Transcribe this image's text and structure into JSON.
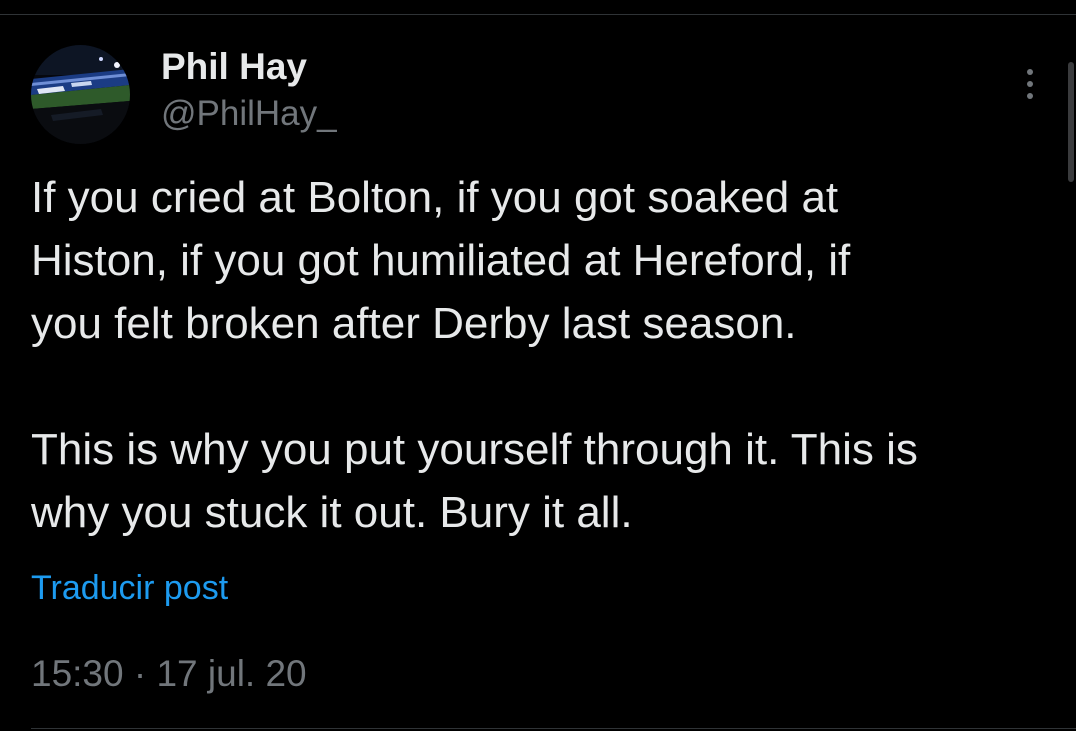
{
  "tweet": {
    "author": {
      "name": "Phil Hay",
      "handle": "@PhilHay_",
      "avatar_icon": "stadium-photo-avatar"
    },
    "more_icon": "more-vertical-icon",
    "text_paragraphs": [
      "If you cried at Bolton, if you got soaked at\nHiston, if you got humiliated at Hereford, if\nyou felt broken after Derby last season.",
      "This is why you put yourself through it. This is\nwhy you stuck it out. Bury it all."
    ],
    "translate_label": "Traducir post",
    "timestamp": "15:30 · 17 jul. 20"
  },
  "colors": {
    "background": "#000000",
    "primary_text": "#e7e9ea",
    "secondary_text": "#71767b",
    "link": "#1d9bf0",
    "divider": "#2f3336"
  }
}
